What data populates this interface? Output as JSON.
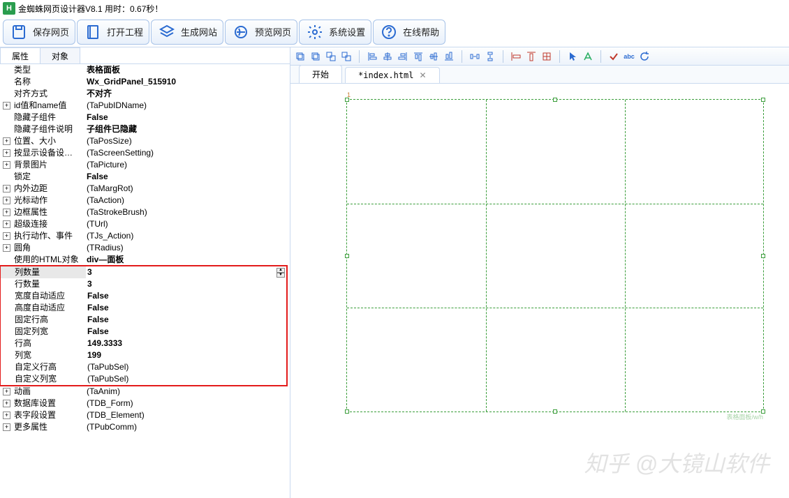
{
  "title": "金蜘蛛网页设计器V8.1  用时：0.67秒！",
  "toolbar": [
    {
      "name": "save-page",
      "label": "保存网页"
    },
    {
      "name": "open-project",
      "label": "打开工程"
    },
    {
      "name": "generate-site",
      "label": "生成网站"
    },
    {
      "name": "preview-page",
      "label": "预览网页"
    },
    {
      "name": "system-settings",
      "label": "系统设置"
    },
    {
      "name": "online-help",
      "label": "在线帮助"
    }
  ],
  "leftTabs": {
    "attr": "属性",
    "obj": "对象"
  },
  "props": [
    {
      "k": "类型",
      "v": "表格面板",
      "bold": true
    },
    {
      "k": "名称",
      "v": "Wx_GridPanel_515910",
      "bold": true
    },
    {
      "k": "对齐方式",
      "v": "不对齐",
      "bold": true
    },
    {
      "k": "id值和name值",
      "v": "(TaPubIDName)",
      "exp": true
    },
    {
      "k": "隐藏子组件",
      "v": "False",
      "bold": true
    },
    {
      "k": "隐藏子组件说明",
      "v": "子组件已隐藏",
      "bold": true
    },
    {
      "k": "位置、大小",
      "v": "(TaPosSize)",
      "exp": true
    },
    {
      "k": "按显示设备设…",
      "v": "(TaScreenSetting)",
      "exp": true
    },
    {
      "k": "背景图片",
      "v": "(TaPicture)",
      "exp": true
    },
    {
      "k": "锁定",
      "v": "False",
      "bold": true
    },
    {
      "k": "内外边距",
      "v": "(TaMargRot)",
      "exp": true
    },
    {
      "k": "光标动作",
      "v": "(TaAction)",
      "exp": true
    },
    {
      "k": "边框属性",
      "v": "(TaStrokeBrush)",
      "exp": true
    },
    {
      "k": "超级连接",
      "v": "(TUrl)",
      "exp": true
    },
    {
      "k": "执行动作、事件",
      "v": "(TJs_Action)",
      "exp": true
    },
    {
      "k": "圆角",
      "v": "(TRadius)",
      "exp": true
    },
    {
      "k": "使用的HTML对象",
      "v": "div—面板",
      "bold": true
    }
  ],
  "redProps": [
    {
      "k": "列数量",
      "v": "3",
      "bold": true,
      "sel": true,
      "spin": true
    },
    {
      "k": "行数量",
      "v": "3",
      "bold": true
    },
    {
      "k": "宽度自动适应",
      "v": "False",
      "bold": true
    },
    {
      "k": "高度自动适应",
      "v": "False",
      "bold": true
    },
    {
      "k": "固定行高",
      "v": "False",
      "bold": true
    },
    {
      "k": "固定列宽",
      "v": "False",
      "bold": true
    },
    {
      "k": "行高",
      "v": "149.3333",
      "bold": true
    },
    {
      "k": "列宽",
      "v": "199",
      "bold": true
    },
    {
      "k": "自定义行高",
      "v": "(TaPubSel)"
    },
    {
      "k": "自定义列宽",
      "v": "(TaPubSel)"
    }
  ],
  "props2": [
    {
      "k": "动画",
      "v": "(TaAnim)",
      "exp": true
    },
    {
      "k": "数据库设置",
      "v": "(TDB_Form)",
      "exp": true
    },
    {
      "k": "表字段设置",
      "v": "(TDB_Element)",
      "exp": true
    },
    {
      "k": "更多属性",
      "v": "(TPubComm)",
      "exp": true
    }
  ],
  "docTabs": {
    "start": "开始",
    "file": "*index.html"
  },
  "panelLabel": "表格面板/w/h",
  "watermark": "知乎 @大镜山软件"
}
